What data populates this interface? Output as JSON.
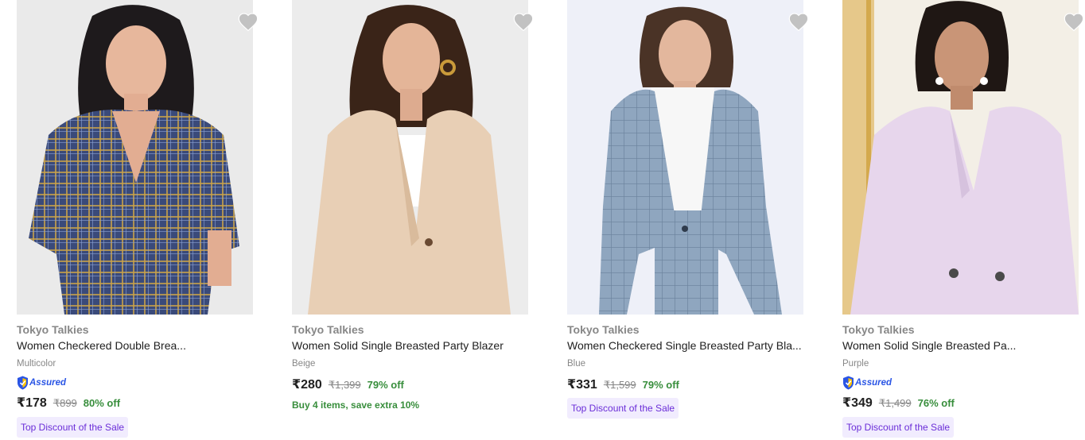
{
  "colors": {
    "brand_text": "#878787",
    "title_text": "#212121",
    "discount_green": "#388e3c",
    "badge_bg": "#f1ecfe",
    "badge_text": "#6b2ed8",
    "assured_blue": "#2a55e5",
    "wishlist_grey": "#c2c2c2"
  },
  "products": [
    {
      "brand": "Tokyo Talkies",
      "title": "Women Checkered Double Brea...",
      "color": "Multicolor",
      "assured": "Assured",
      "price": "₹178",
      "mrp": "₹899",
      "discount": "80% off",
      "badge": "Top Discount of the Sale",
      "image_icon": "product-photo-checkered-blazer",
      "wishlist_icon": "heart-icon"
    },
    {
      "brand": "Tokyo Talkies",
      "title": "Women Solid Single Breasted Party Blazer",
      "color": "Beige",
      "price": "₹280",
      "mrp": "₹1,399",
      "discount": "79% off",
      "offer": "Buy 4 items, save extra 10%",
      "image_icon": "product-photo-beige-blazer",
      "wishlist_icon": "heart-icon"
    },
    {
      "brand": "Tokyo Talkies",
      "title": "Women Checkered Single Breasted Party Bla...",
      "color": "Blue",
      "price": "₹331",
      "mrp": "₹1,599",
      "discount": "79% off",
      "badge": "Top Discount of the Sale",
      "image_icon": "product-photo-blue-blazer",
      "wishlist_icon": "heart-icon"
    },
    {
      "brand": "Tokyo Talkies",
      "title": "Women Solid Single Breasted Pa...",
      "color": "Purple",
      "assured": "Assured",
      "price": "₹349",
      "mrp": "₹1,499",
      "discount": "76% off",
      "badge": "Top Discount of the Sale",
      "image_icon": "product-photo-purple-blazer",
      "wishlist_icon": "heart-icon"
    }
  ]
}
